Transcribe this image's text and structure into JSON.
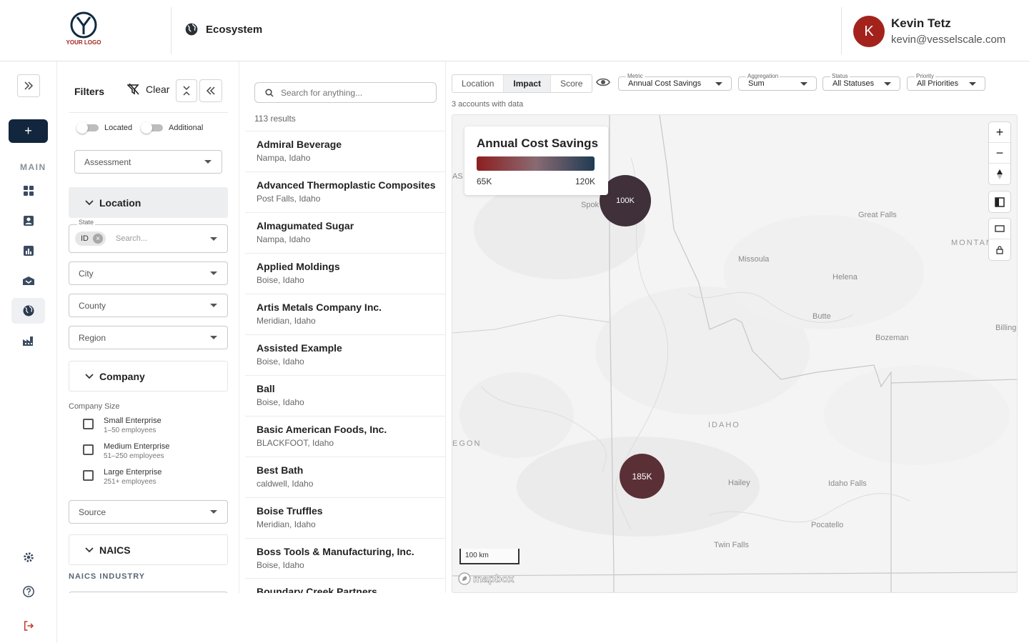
{
  "header": {
    "logo_text": "YOUR LOGO",
    "app_title": "Ecosystem",
    "user": {
      "initial": "K",
      "name": "Kevin Tetz",
      "email": "kevin@vesselscale.com"
    }
  },
  "rail": {
    "section_label": "MAIN",
    "new_label": "+",
    "items": [
      "dashboard-icon",
      "contacts-icon",
      "chart-icon",
      "handshake-icon",
      "globe-icon",
      "factory-icon"
    ],
    "active_item": "globe-icon",
    "bottom": [
      "settings-icon",
      "help-icon",
      "logout-icon"
    ]
  },
  "filters": {
    "title": "Filters",
    "clear_label": "Clear",
    "toggles": [
      {
        "label": "Located",
        "on": false
      },
      {
        "label": "Additional",
        "on": false
      }
    ],
    "assessment_placeholder": "Assessment",
    "location": {
      "label": "Location",
      "state_label": "State",
      "state_chip": "ID",
      "state_placeholder": "Search...",
      "city_placeholder": "City",
      "county_placeholder": "County",
      "region_placeholder": "Region"
    },
    "company": {
      "label": "Company",
      "size_label": "Company Size",
      "sizes": [
        {
          "title": "Small Enterprise",
          "sub": "1–50 employees"
        },
        {
          "title": "Medium Enterprise",
          "sub": "51–250 employees"
        },
        {
          "title": "Large Enterprise",
          "sub": "251+ employees"
        }
      ],
      "source_placeholder": "Source"
    },
    "naics": {
      "label": "NAICS",
      "industry_label": "NAICS INDUSTRY"
    }
  },
  "results": {
    "search_placeholder": "Search for anything...",
    "count": "113 results",
    "items": [
      {
        "name": "Admiral Beverage",
        "location": "Nampa, Idaho"
      },
      {
        "name": "Advanced Thermoplastic Composites",
        "location": "Post Falls, Idaho"
      },
      {
        "name": "Almagumated Sugar",
        "location": "Nampa, Idaho"
      },
      {
        "name": "Applied Moldings",
        "location": "Boise, Idaho"
      },
      {
        "name": "Artis Metals Company Inc.",
        "location": "Meridian, Idaho"
      },
      {
        "name": "Assisted Example",
        "location": "Boise, Idaho"
      },
      {
        "name": "Ball",
        "location": "Boise, Idaho"
      },
      {
        "name": "Basic American Foods, Inc.",
        "location": "BLACKFOOT, Idaho"
      },
      {
        "name": "Best Bath",
        "location": "caldwell, Idaho"
      },
      {
        "name": "Boise Truffles",
        "location": "Meridian, Idaho"
      },
      {
        "name": "Boss Tools & Manufacturing, Inc.",
        "location": "Boise, Idaho"
      },
      {
        "name": "Boundary Creek Partners",
        "location": ""
      }
    ]
  },
  "map_panel": {
    "view_tabs": [
      "Location",
      "Impact",
      "Score"
    ],
    "active_tab": "Impact",
    "controls": [
      {
        "label": "Metric",
        "value": "Annual Cost Savings"
      },
      {
        "label": "Aggregation",
        "value": "Sum"
      },
      {
        "label": "Status",
        "value": "All Statuses"
      },
      {
        "label": "Priority",
        "value": "All Priorities"
      }
    ],
    "accounts_note": "3 accounts with data",
    "legend": {
      "title": "Annual Cost Savings",
      "min": "65K",
      "max": "120K",
      "colors": [
        "#8c1f1f",
        "#8a6a72",
        "#1f3b54"
      ]
    },
    "bubbles": [
      {
        "label": "100K",
        "color": "#3f3039"
      },
      {
        "label": "185K",
        "color": "#5a2f36"
      }
    ],
    "places": {
      "spokane": "Spok",
      "great_falls": "Great Falls",
      "montana": "MONTANA",
      "missoula": "Missoula",
      "helena": "Helena",
      "butte": "Butte",
      "bozeman": "Bozeman",
      "billings": "Billing",
      "idaho": "IDAHO",
      "oregon": "EGON",
      "hailey": "Hailey",
      "idaho_falls": "Idaho Falls",
      "pocatello": "Pocatello",
      "twin_falls": "Twin Falls",
      "wa": "AS"
    },
    "scale_label": "100 km",
    "attribution": "mapbox",
    "zoom_in": "+",
    "zoom_out": "−"
  }
}
